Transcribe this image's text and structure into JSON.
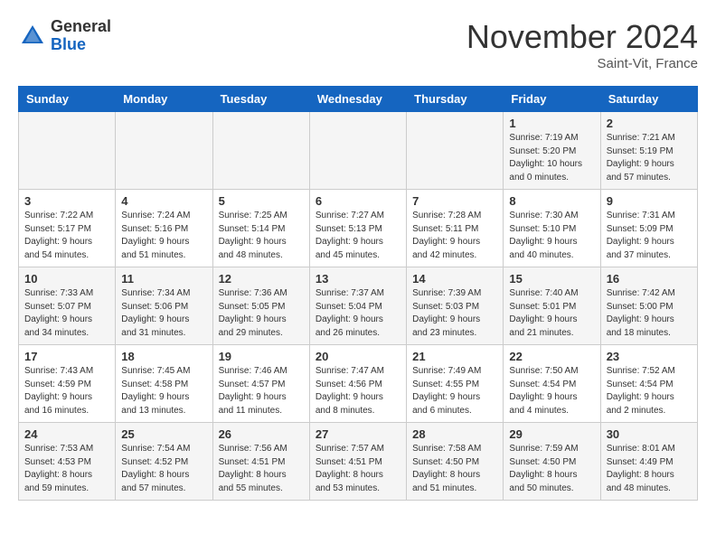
{
  "header": {
    "logo_general": "General",
    "logo_blue": "Blue",
    "month_title": "November 2024",
    "subtitle": "Saint-Vit, France"
  },
  "weekdays": [
    "Sunday",
    "Monday",
    "Tuesday",
    "Wednesday",
    "Thursday",
    "Friday",
    "Saturday"
  ],
  "weeks": [
    [
      {
        "day": "",
        "info": ""
      },
      {
        "day": "",
        "info": ""
      },
      {
        "day": "",
        "info": ""
      },
      {
        "day": "",
        "info": ""
      },
      {
        "day": "",
        "info": ""
      },
      {
        "day": "1",
        "info": "Sunrise: 7:19 AM\nSunset: 5:20 PM\nDaylight: 10 hours\nand 0 minutes."
      },
      {
        "day": "2",
        "info": "Sunrise: 7:21 AM\nSunset: 5:19 PM\nDaylight: 9 hours\nand 57 minutes."
      }
    ],
    [
      {
        "day": "3",
        "info": "Sunrise: 7:22 AM\nSunset: 5:17 PM\nDaylight: 9 hours\nand 54 minutes."
      },
      {
        "day": "4",
        "info": "Sunrise: 7:24 AM\nSunset: 5:16 PM\nDaylight: 9 hours\nand 51 minutes."
      },
      {
        "day": "5",
        "info": "Sunrise: 7:25 AM\nSunset: 5:14 PM\nDaylight: 9 hours\nand 48 minutes."
      },
      {
        "day": "6",
        "info": "Sunrise: 7:27 AM\nSunset: 5:13 PM\nDaylight: 9 hours\nand 45 minutes."
      },
      {
        "day": "7",
        "info": "Sunrise: 7:28 AM\nSunset: 5:11 PM\nDaylight: 9 hours\nand 42 minutes."
      },
      {
        "day": "8",
        "info": "Sunrise: 7:30 AM\nSunset: 5:10 PM\nDaylight: 9 hours\nand 40 minutes."
      },
      {
        "day": "9",
        "info": "Sunrise: 7:31 AM\nSunset: 5:09 PM\nDaylight: 9 hours\nand 37 minutes."
      }
    ],
    [
      {
        "day": "10",
        "info": "Sunrise: 7:33 AM\nSunset: 5:07 PM\nDaylight: 9 hours\nand 34 minutes."
      },
      {
        "day": "11",
        "info": "Sunrise: 7:34 AM\nSunset: 5:06 PM\nDaylight: 9 hours\nand 31 minutes."
      },
      {
        "day": "12",
        "info": "Sunrise: 7:36 AM\nSunset: 5:05 PM\nDaylight: 9 hours\nand 29 minutes."
      },
      {
        "day": "13",
        "info": "Sunrise: 7:37 AM\nSunset: 5:04 PM\nDaylight: 9 hours\nand 26 minutes."
      },
      {
        "day": "14",
        "info": "Sunrise: 7:39 AM\nSunset: 5:03 PM\nDaylight: 9 hours\nand 23 minutes."
      },
      {
        "day": "15",
        "info": "Sunrise: 7:40 AM\nSunset: 5:01 PM\nDaylight: 9 hours\nand 21 minutes."
      },
      {
        "day": "16",
        "info": "Sunrise: 7:42 AM\nSunset: 5:00 PM\nDaylight: 9 hours\nand 18 minutes."
      }
    ],
    [
      {
        "day": "17",
        "info": "Sunrise: 7:43 AM\nSunset: 4:59 PM\nDaylight: 9 hours\nand 16 minutes."
      },
      {
        "day": "18",
        "info": "Sunrise: 7:45 AM\nSunset: 4:58 PM\nDaylight: 9 hours\nand 13 minutes."
      },
      {
        "day": "19",
        "info": "Sunrise: 7:46 AM\nSunset: 4:57 PM\nDaylight: 9 hours\nand 11 minutes."
      },
      {
        "day": "20",
        "info": "Sunrise: 7:47 AM\nSunset: 4:56 PM\nDaylight: 9 hours\nand 8 minutes."
      },
      {
        "day": "21",
        "info": "Sunrise: 7:49 AM\nSunset: 4:55 PM\nDaylight: 9 hours\nand 6 minutes."
      },
      {
        "day": "22",
        "info": "Sunrise: 7:50 AM\nSunset: 4:54 PM\nDaylight: 9 hours\nand 4 minutes."
      },
      {
        "day": "23",
        "info": "Sunrise: 7:52 AM\nSunset: 4:54 PM\nDaylight: 9 hours\nand 2 minutes."
      }
    ],
    [
      {
        "day": "24",
        "info": "Sunrise: 7:53 AM\nSunset: 4:53 PM\nDaylight: 8 hours\nand 59 minutes."
      },
      {
        "day": "25",
        "info": "Sunrise: 7:54 AM\nSunset: 4:52 PM\nDaylight: 8 hours\nand 57 minutes."
      },
      {
        "day": "26",
        "info": "Sunrise: 7:56 AM\nSunset: 4:51 PM\nDaylight: 8 hours\nand 55 minutes."
      },
      {
        "day": "27",
        "info": "Sunrise: 7:57 AM\nSunset: 4:51 PM\nDaylight: 8 hours\nand 53 minutes."
      },
      {
        "day": "28",
        "info": "Sunrise: 7:58 AM\nSunset: 4:50 PM\nDaylight: 8 hours\nand 51 minutes."
      },
      {
        "day": "29",
        "info": "Sunrise: 7:59 AM\nSunset: 4:50 PM\nDaylight: 8 hours\nand 50 minutes."
      },
      {
        "day": "30",
        "info": "Sunrise: 8:01 AM\nSunset: 4:49 PM\nDaylight: 8 hours\nand 48 minutes."
      }
    ]
  ]
}
